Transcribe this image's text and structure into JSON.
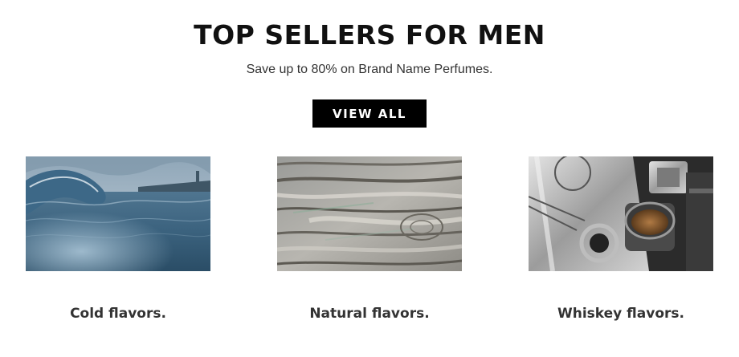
{
  "header": {
    "title": "TOP SELLERS FOR MEN",
    "subtitle": "Save up to 80% on Brand Name Perfumes.",
    "cta_label": "VIEW ALL"
  },
  "cards": [
    {
      "label": "Cold flavors.",
      "image": "ocean-wave-image"
    },
    {
      "label": "Natural flavors.",
      "image": "tree-bark-image"
    },
    {
      "label": "Whiskey flavors.",
      "image": "whiskey-flask-image"
    }
  ],
  "colors": {
    "button_bg": "#000000",
    "button_text": "#ffffff",
    "text": "#111111"
  }
}
